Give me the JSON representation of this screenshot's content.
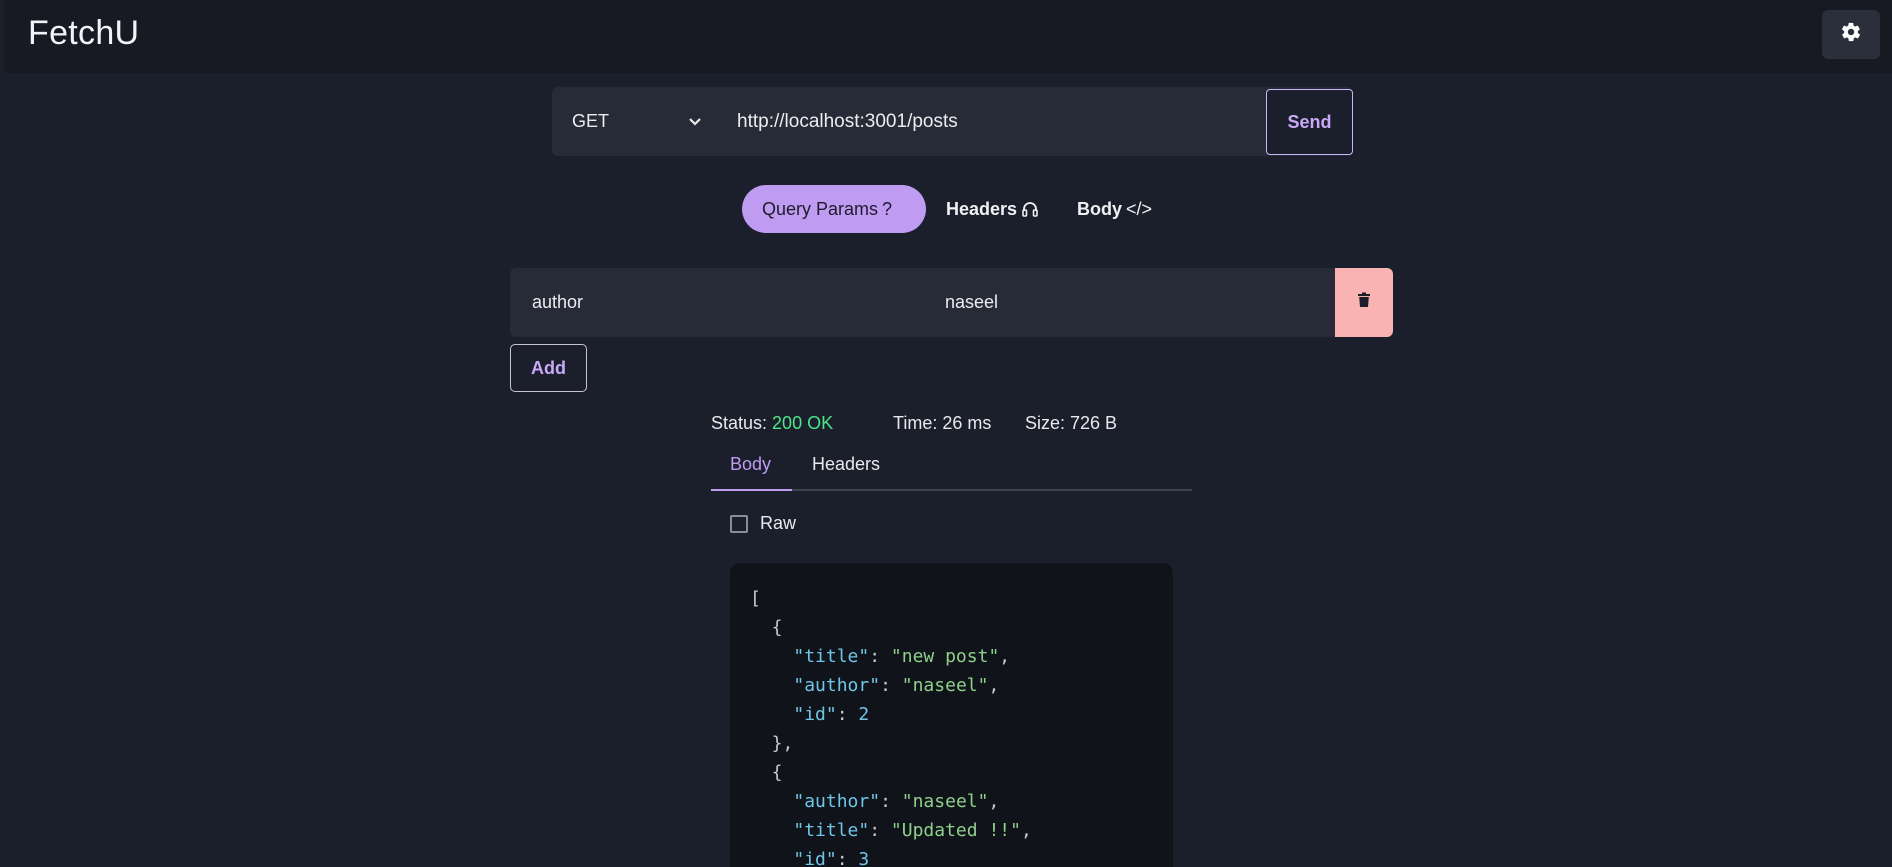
{
  "app": {
    "title": "FetchU",
    "settings_icon": "gear-icon"
  },
  "request": {
    "method": "GET",
    "url": "http://localhost:3001/posts",
    "send_label": "Send"
  },
  "tabs": [
    {
      "label": "Query Params",
      "icon": "question-mark-icon",
      "glyph": "?",
      "active": true
    },
    {
      "label": "Headers",
      "icon": "headphones-icon",
      "active": false
    },
    {
      "label": "Body",
      "icon": "code-icon",
      "glyph": "</>",
      "active": false
    }
  ],
  "params": [
    {
      "key": "author",
      "value": "naseel"
    }
  ],
  "add_label": "Add",
  "response": {
    "status_label": "Status:",
    "status_value": "200 OK",
    "time_label": "Time: 26 ms",
    "size_label": "Size: 726 B",
    "tabs": [
      "Body",
      "Headers"
    ],
    "active_tab": "Body",
    "raw_label": "Raw",
    "raw_checked": false,
    "json": [
      {
        "title": "new post",
        "author": "naseel",
        "id": 2
      },
      {
        "author": "naseel",
        "title": "Updated !!",
        "id": 3
      }
    ]
  },
  "colors": {
    "accent": "#c09bf2",
    "status_ok": "#4ee58a",
    "delete": "#fab3b3",
    "background": "#1b1f2b"
  }
}
